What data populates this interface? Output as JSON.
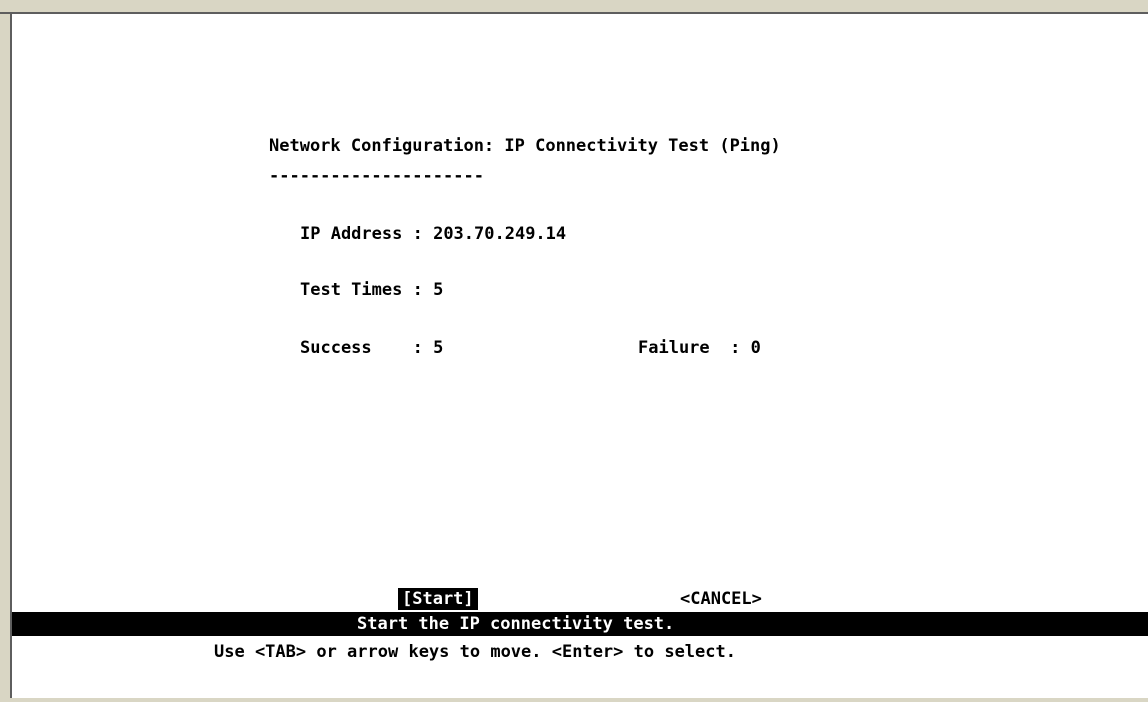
{
  "title": "Network Configuration: IP Connectivity Test (Ping)",
  "title_underline": "---------------------",
  "fields": {
    "ip_address_label": "IP Address",
    "ip_address_value": "203.70.249.14",
    "test_times_label": "Test Times",
    "test_times_value": "5",
    "success_label": "Success",
    "success_value": "5",
    "failure_label": "Failure",
    "failure_value": "0"
  },
  "buttons": {
    "start_label": "[Start]",
    "cancel_label": "<CANCEL>"
  },
  "status_bar": {
    "message": "Start the IP connectivity test."
  },
  "help": {
    "text": "Use <TAB> or arrow keys to move. <Enter> to select."
  },
  "colors": {
    "frame": "#d9d6c4",
    "screen_background": "#ffffff",
    "text": "#000000",
    "highlight_background": "#000000",
    "highlight_text": "#ffffff"
  }
}
